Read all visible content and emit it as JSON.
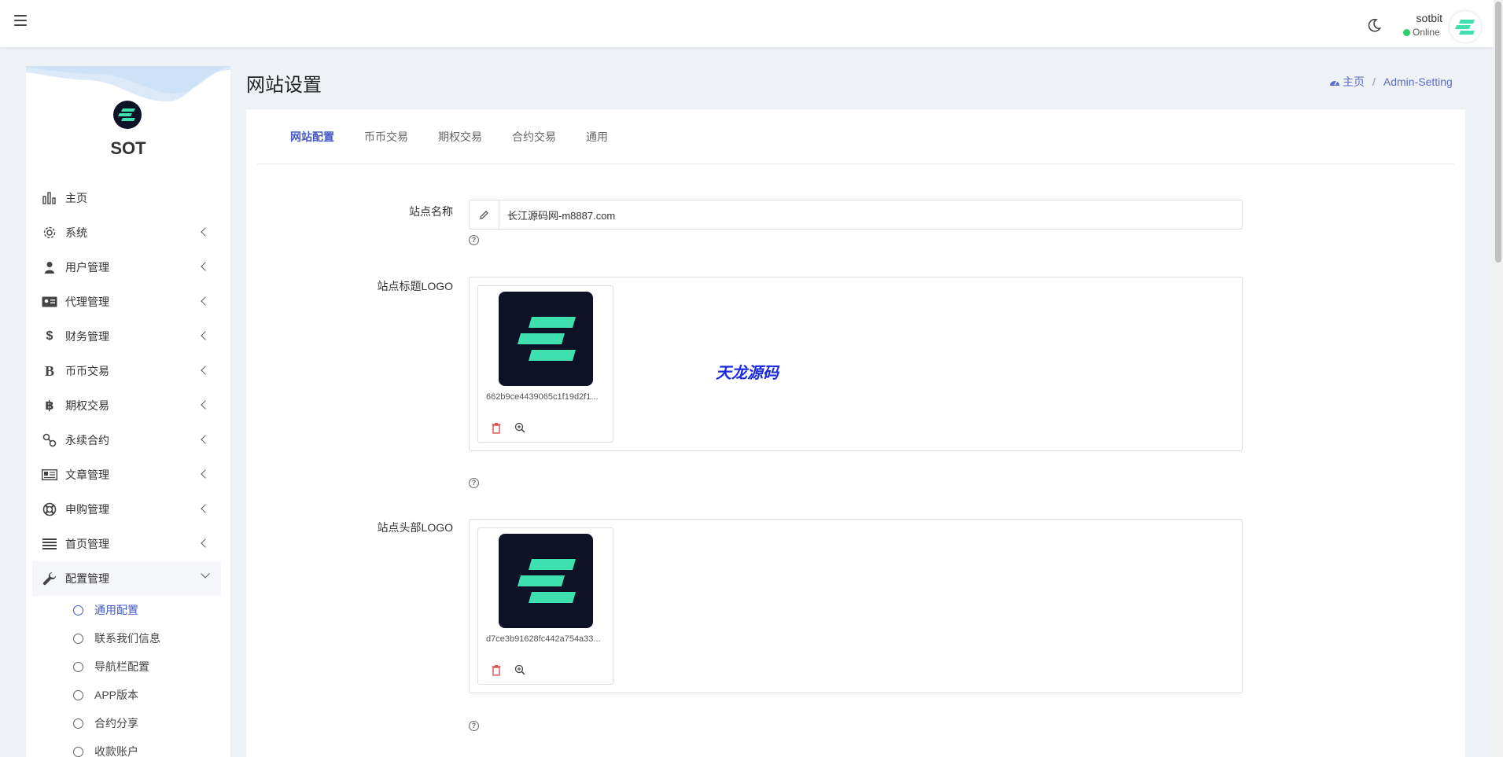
{
  "topbar": {
    "user_name": "sotbit",
    "user_status": "Online"
  },
  "brand": {
    "name": "SOT"
  },
  "sidebar": {
    "items": [
      {
        "label": "主页",
        "icon": "bar-chart-icon"
      },
      {
        "label": "系统",
        "icon": "gear-icon"
      },
      {
        "label": "用户管理",
        "icon": "user-tie-icon"
      },
      {
        "label": "代理管理",
        "icon": "id-card-icon"
      },
      {
        "label": "财务管理",
        "icon": "dollar-icon"
      },
      {
        "label": "币币交易",
        "icon": "bold-b-icon"
      },
      {
        "label": "期权交易",
        "icon": "bitcoin-icon"
      },
      {
        "label": "永续合约",
        "icon": "link-icon"
      },
      {
        "label": "文章管理",
        "icon": "newspaper-icon"
      },
      {
        "label": "申购管理",
        "icon": "lifebuoy-icon"
      },
      {
        "label": "首页管理",
        "icon": "list-icon"
      },
      {
        "label": "配置管理",
        "icon": "wrench-icon"
      }
    ],
    "subitems": [
      {
        "label": "通用配置",
        "active": true
      },
      {
        "label": "联系我们信息"
      },
      {
        "label": "导航栏配置"
      },
      {
        "label": "APP版本"
      },
      {
        "label": "合约分享"
      },
      {
        "label": "收款账户"
      }
    ]
  },
  "page": {
    "title": "网站设置",
    "breadcrumb_home": "主页",
    "breadcrumb_current": "Admin-Setting"
  },
  "tabs": [
    "网站配置",
    "币币交易",
    "期权交易",
    "合约交易",
    "通用"
  ],
  "form": {
    "site_name_label": "站点名称",
    "site_name_value": "长江源码网-m8887.com",
    "title_logo_label": "站点标题LOGO",
    "title_logo_file": "662b9ce4439065c1f19d2f1...",
    "header_logo_label": "站点头部LOGO",
    "header_logo_file": "d7ce3b91628fc442a754a33..."
  },
  "watermark": "天龙源码",
  "colors": {
    "accent": "#4458c8",
    "online": "#2ecc71",
    "logo_bg": "#0d1226",
    "logo_green": "#3ee0b0"
  }
}
